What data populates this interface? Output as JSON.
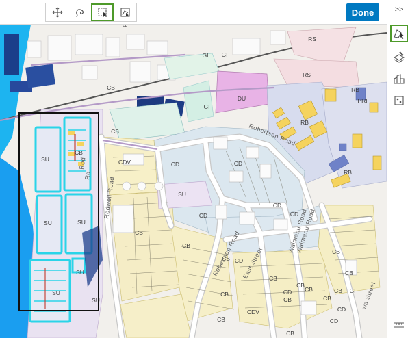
{
  "toolbar": {
    "tools": [
      {
        "name": "move-tool",
        "icon": "move-arrows-icon",
        "active": false
      },
      {
        "name": "lasso-select-tool",
        "icon": "lasso-icon",
        "active": false
      },
      {
        "name": "rectangle-select-tool",
        "icon": "rectangle-select-icon",
        "active": true
      },
      {
        "name": "select-by-shape-tool",
        "icon": "select-by-shape-icon",
        "active": false
      }
    ],
    "done_label": "Done"
  },
  "right_panel": {
    "expand_label": ">>",
    "tools": [
      {
        "name": "select-features",
        "icon": "select-features-icon",
        "active": true
      },
      {
        "name": "edit-layers",
        "icon": "layers-edit-icon",
        "active": false
      },
      {
        "name": "smart-feature-tool",
        "icon": "building-icon",
        "active": false
      },
      {
        "name": "attributes-tool",
        "icon": "attributes-icon",
        "active": false
      }
    ],
    "bottom_icon": "measure-collapse-icon"
  },
  "map": {
    "accent_selection": "#2ad4e8",
    "selection_box_color": "#111111",
    "zone_labels": [
      {
        "text": "RS"
      },
      {
        "text": "RS"
      },
      {
        "text": "GI"
      },
      {
        "text": "GI"
      },
      {
        "text": "DU"
      },
      {
        "text": "CB"
      },
      {
        "text": "RB"
      },
      {
        "text": "PRF"
      },
      {
        "text": "RB"
      },
      {
        "text": "RB"
      },
      {
        "text": "CB"
      },
      {
        "text": "CB"
      },
      {
        "text": "SU"
      },
      {
        "text": "CDV"
      },
      {
        "text": "CD"
      },
      {
        "text": "CD"
      },
      {
        "text": "SU"
      },
      {
        "text": "SU"
      },
      {
        "text": "CD"
      },
      {
        "text": "SU"
      },
      {
        "text": "SU"
      },
      {
        "text": "CD"
      },
      {
        "text": "CD"
      },
      {
        "text": "CB"
      },
      {
        "text": "CB"
      },
      {
        "text": "CB"
      },
      {
        "text": "CD"
      },
      {
        "text": "CB"
      },
      {
        "text": "SU"
      },
      {
        "text": "SU"
      },
      {
        "text": "CB"
      },
      {
        "text": "CB"
      },
      {
        "text": "GI"
      },
      {
        "text": "CB"
      },
      {
        "text": "CB"
      },
      {
        "text": "CB"
      },
      {
        "text": "CDV"
      },
      {
        "text": "CB"
      },
      {
        "text": "CB"
      },
      {
        "text": "CD"
      },
      {
        "text": "CD"
      },
      {
        "text": "CD"
      },
      {
        "text": "CB"
      },
      {
        "text": "CB"
      },
      {
        "text": "CB"
      },
      {
        "text": "GI"
      }
    ],
    "road_labels": [
      {
        "text": "Rodwell Road"
      },
      {
        "text": "Robertson Road"
      },
      {
        "text": "Robertson Road"
      },
      {
        "text": "East Street"
      },
      {
        "text": "Waimanu Road"
      },
      {
        "text": "Waimanu Road"
      },
      {
        "text": "Rd"
      },
      {
        "text": "F"
      },
      {
        "text": "Rod"
      },
      {
        "text": "wa Street"
      }
    ]
  }
}
